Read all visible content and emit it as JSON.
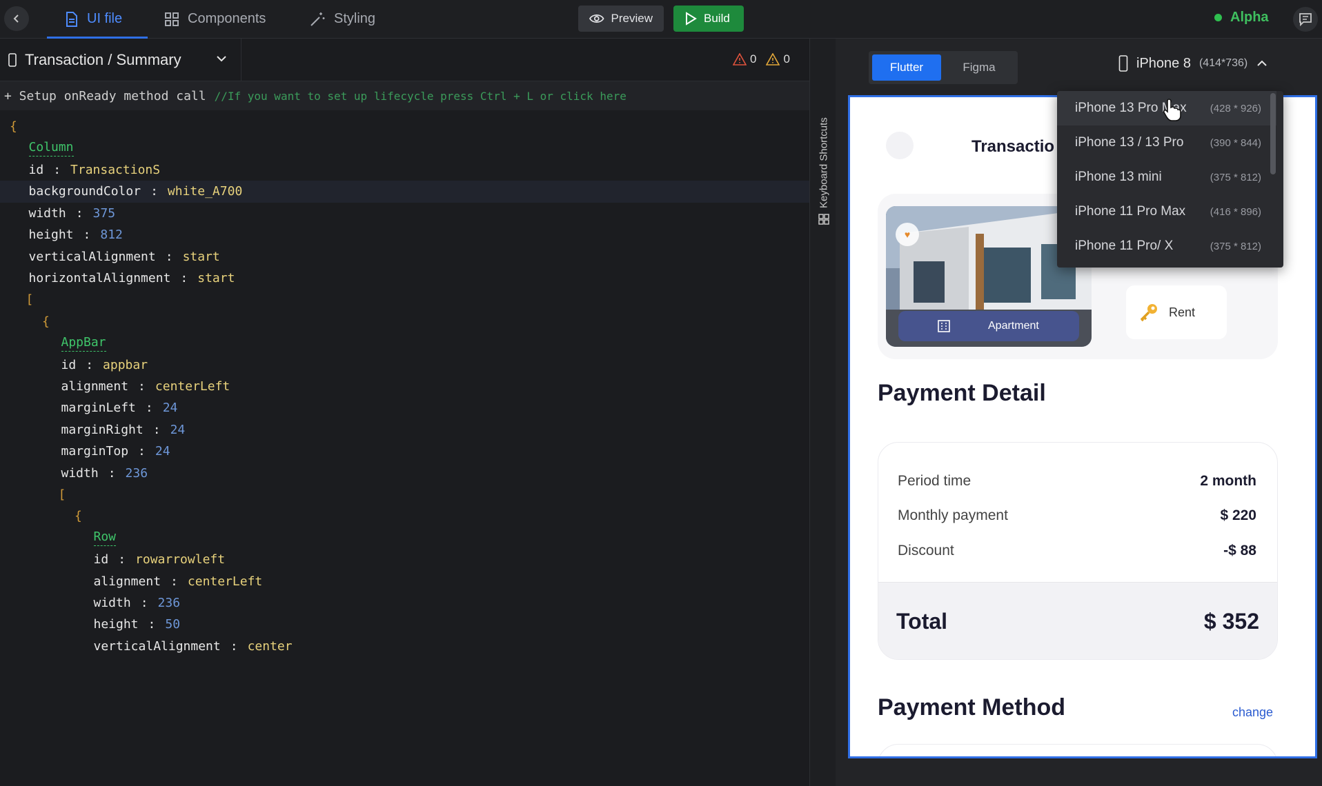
{
  "topbar": {
    "tabs": [
      {
        "label": "UI file",
        "icon": "file-icon"
      },
      {
        "label": "Components",
        "icon": "grid-icon"
      },
      {
        "label": "Styling",
        "icon": "magic-wand-icon"
      }
    ],
    "preview_label": "Preview",
    "build_label": "Build",
    "env_label": "Alpha"
  },
  "editor": {
    "file_title": "Transaction / Summary",
    "error_count": "0",
    "warning_count": "0",
    "setup": {
      "text": "+ Setup onReady method call",
      "comment": "//If you want to set up lifecycle press Ctrl + L or click here"
    },
    "lines": [
      {
        "indent": 0,
        "type": "brace",
        "text": "{"
      },
      {
        "indent": 1,
        "type": "widget",
        "text": "Column"
      },
      {
        "indent": 1,
        "type": "prop",
        "key": "id",
        "value": "TransactionS",
        "vtype": "str"
      },
      {
        "indent": 1,
        "type": "prop",
        "key": "backgroundColor",
        "value": "white_A700",
        "vtype": "str",
        "highlight": true
      },
      {
        "indent": 1,
        "type": "prop",
        "key": "width",
        "value": "375",
        "vtype": "num"
      },
      {
        "indent": 1,
        "type": "prop",
        "key": "height",
        "value": "812",
        "vtype": "num"
      },
      {
        "indent": 1,
        "type": "prop",
        "key": "verticalAlignment",
        "value": "start",
        "vtype": "str"
      },
      {
        "indent": 1,
        "type": "prop",
        "key": "horizontalAlignment",
        "value": "start",
        "vtype": "str"
      },
      {
        "indent": 1,
        "type": "brace",
        "text": "["
      },
      {
        "indent": 2,
        "type": "brace",
        "text": "{"
      },
      {
        "indent": 3,
        "type": "widget",
        "text": "AppBar"
      },
      {
        "indent": 3,
        "type": "prop",
        "key": "id",
        "value": "appbar",
        "vtype": "str"
      },
      {
        "indent": 3,
        "type": "prop",
        "key": "alignment",
        "value": "centerLeft",
        "vtype": "str"
      },
      {
        "indent": 3,
        "type": "prop",
        "key": "marginLeft",
        "value": "24",
        "vtype": "num"
      },
      {
        "indent": 3,
        "type": "prop",
        "key": "marginRight",
        "value": "24",
        "vtype": "num"
      },
      {
        "indent": 3,
        "type": "prop",
        "key": "marginTop",
        "value": "24",
        "vtype": "num"
      },
      {
        "indent": 3,
        "type": "prop",
        "key": "width",
        "value": "236",
        "vtype": "num"
      },
      {
        "indent": 3,
        "type": "brace",
        "text": "["
      },
      {
        "indent": 4,
        "type": "brace",
        "text": "{"
      },
      {
        "indent": 5,
        "type": "widget",
        "text": "Row"
      },
      {
        "indent": 5,
        "type": "prop",
        "key": "id",
        "value": "rowarrowleft",
        "vtype": "str"
      },
      {
        "indent": 5,
        "type": "prop",
        "key": "alignment",
        "value": "centerLeft",
        "vtype": "str"
      },
      {
        "indent": 5,
        "type": "prop",
        "key": "width",
        "value": "236",
        "vtype": "num"
      },
      {
        "indent": 5,
        "type": "prop",
        "key": "height",
        "value": "50",
        "vtype": "num"
      },
      {
        "indent": 5,
        "type": "prop",
        "key": "verticalAlignment",
        "value": "center",
        "vtype": "str"
      }
    ]
  },
  "shortcuts_label": "Keyboard Shortcuts",
  "preview": {
    "frameworks": [
      "Flutter",
      "Figma"
    ],
    "selected_framework": "Flutter",
    "device": {
      "name": "iPhone 8",
      "dims": "(414*736)"
    },
    "device_options": [
      {
        "name": "iPhone 13 Pro Max",
        "dims": "(428 * 926)"
      },
      {
        "name": "iPhone 13 / 13 Pro",
        "dims": "(390 * 844)"
      },
      {
        "name": "iPhone 13 mini",
        "dims": "(375 * 812)"
      },
      {
        "name": "iPhone 11 Pro Max",
        "dims": "(416 * 896)"
      },
      {
        "name": "iPhone 11 Pro/ X",
        "dims": "(375 * 812)"
      }
    ],
    "phone": {
      "title": "Transactio",
      "property_type": "Apartment",
      "rent_label": "Rent",
      "payment_detail_heading": "Payment Detail",
      "details": [
        {
          "label": "Period time",
          "value": "2 month"
        },
        {
          "label": "Monthly payment",
          "value": "$ 220"
        },
        {
          "label": "Discount",
          "value": "-$ 88"
        }
      ],
      "total_label": "Total",
      "total_value": "$ 352",
      "payment_method_heading": "Payment Method",
      "change_label": "change"
    }
  }
}
